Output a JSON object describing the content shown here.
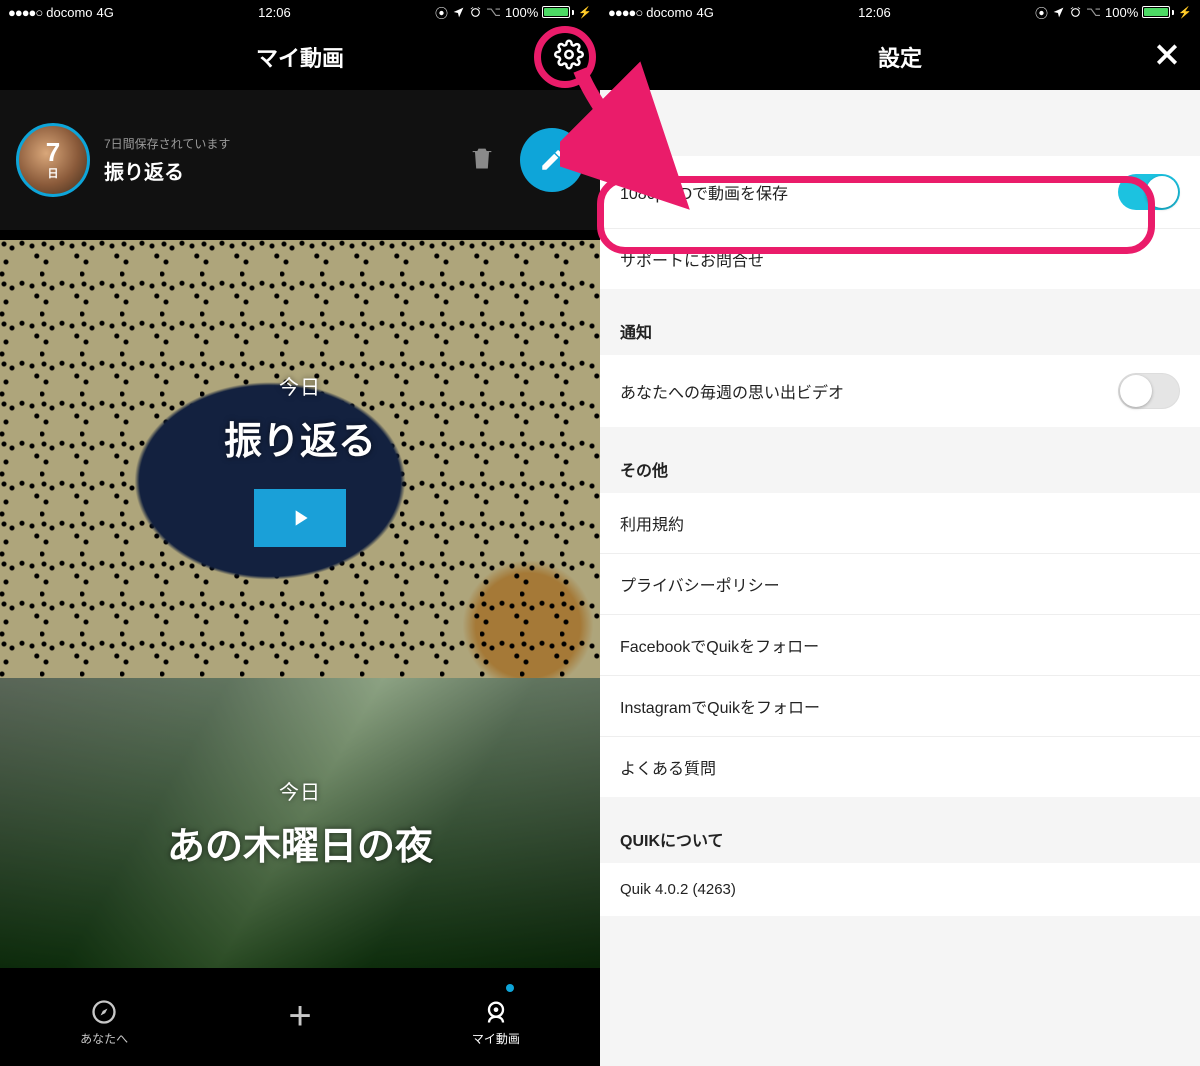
{
  "status": {
    "signal": "●●●●○",
    "carrier": "docomo",
    "network": "4G",
    "time": "12:06",
    "battery_pct": "100%"
  },
  "left": {
    "nav_title": "マイ動画",
    "pending": {
      "days_num": "7",
      "days_unit": "日",
      "sub": "7日間保存されています",
      "title": "振り返る"
    },
    "videos": [
      {
        "date": "今日",
        "title": "振り返る",
        "has_play": true
      },
      {
        "date": "今日",
        "title": "あの木曜日の夜",
        "has_play": false
      }
    ],
    "tabs": {
      "for_you": "あなたへ",
      "my_videos": "マイ動画"
    }
  },
  "right": {
    "nav_title": "設定",
    "sections": {
      "general": {
        "header": "一般",
        "save_1080p": "1080p HDで動画を保存",
        "save_1080p_on": true,
        "support": "サポートにお問合せ"
      },
      "notifications": {
        "header": "通知",
        "weekly": "あなたへの毎週の思い出ビデオ",
        "weekly_on": false
      },
      "other": {
        "header": "その他",
        "terms": "利用規約",
        "privacy": "プライバシーポリシー",
        "facebook": "FacebookでQuikをフォロー",
        "instagram": "InstagramでQuikをフォロー",
        "faq": "よくある質問"
      },
      "about": {
        "header": "QUIKについて",
        "version": "Quik 4.0.2 (4263)"
      }
    }
  }
}
